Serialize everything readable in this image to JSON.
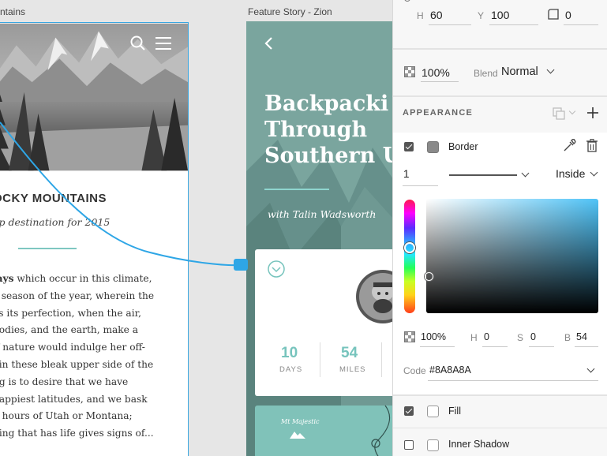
{
  "canvas": {
    "artboard1": {
      "title": "ntains",
      "heading": "OCKY MOUNTAINS",
      "subtitle": "op destination for 2015",
      "body_lines": [
        {
          "bold": "lays",
          "text": " which occur in this climate,"
        },
        {
          "bold": "",
          "text": "y season of the year, wherein the"
        },
        {
          "bold": "",
          "text": "es its perfection, when the air,"
        },
        {
          "bold": "",
          "text": " bodies, and the earth, make a"
        },
        {
          "bold": "",
          "text": "if nature would indulge her off-"
        },
        {
          "bold": "",
          "text": ", in these bleak upper side of the"
        },
        {
          "bold": "",
          "text": "ng is to desire that we have"
        },
        {
          "bold": "",
          "text": "happiest latitudes, and we bask"
        },
        {
          "bold": "",
          "text": "g hours of Utah or Montana;"
        },
        {
          "bold": "",
          "text": "hing that has life gives signs of..."
        }
      ]
    },
    "artboard2": {
      "title": "Feature Story - Zion",
      "headline": [
        "Backpacki",
        "Through",
        "Southern U"
      ],
      "byline": "with Talin Wadsworth",
      "stats": [
        {
          "value": "10",
          "label": "DAYS"
        },
        {
          "value": "54",
          "label": "MILES"
        }
      ],
      "card_caption": "Mt Majestic"
    }
  },
  "panel": {
    "size": {
      "h_label": "H",
      "h_value": "60",
      "y_label": "Y",
      "y_value": "100",
      "radius_value": "0"
    },
    "opacity": {
      "value": "100%",
      "blend_label": "Blend",
      "blend_value": "Normal"
    },
    "appearance": {
      "title": "APPEARANCE",
      "border": {
        "label": "Border",
        "enabled": true,
        "color": "#8A8A8A",
        "width": "1",
        "position": "Inside"
      }
    },
    "color_picker": {
      "alpha": "100%",
      "h_label": "H",
      "h_value": "0",
      "s_label": "S",
      "s_value": "0",
      "b_label": "B",
      "b_value": "54",
      "code_label": "Code",
      "code_value": "#8A8A8A"
    },
    "fill": {
      "label": "Fill",
      "enabled": true
    },
    "inner_shadow": {
      "label": "Inner Shadow",
      "enabled": false
    }
  },
  "colors": {
    "accent": "#3aa6e0",
    "teal": "#77c4bd",
    "hue_blue": "#4fc3f7"
  }
}
